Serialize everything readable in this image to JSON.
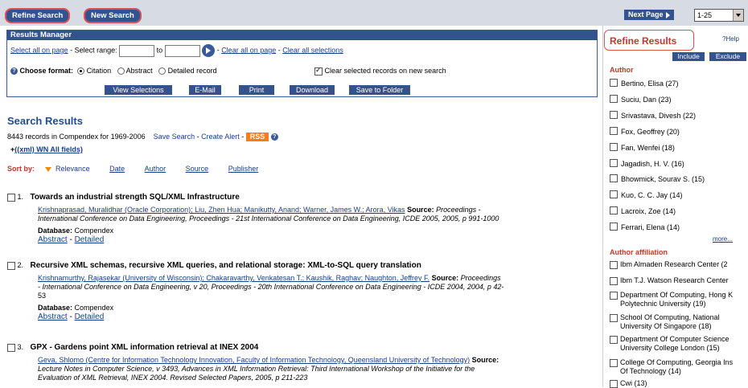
{
  "toolbar": {
    "refine_search": "Refine Search",
    "new_search": "New Search",
    "next_page": "Next Page",
    "page_range": "1-25"
  },
  "results_manager": {
    "title": "Results Manager",
    "select_all_on_page": "Select all on page",
    "select_range": "- Select range:",
    "to": "to",
    "clear_all_on_page": "Clear all on page",
    "clear_all_selections": "Clear all selections",
    "choose_format": "Choose format:",
    "formats": [
      "Citation",
      "Abstract",
      "Detailed record"
    ],
    "selected_format": "Citation",
    "clear_selected": "Clear selected records on new search",
    "buttons": [
      "View Selections",
      "E-Mail",
      "Print",
      "Download",
      "Save to Folder"
    ]
  },
  "results": {
    "title": "Search Results",
    "summary": "8443 records in Compendex for 1969-2006",
    "save_search": "Save Search",
    "create_alert": "Create Alert",
    "rss": "RSS",
    "query": "((xml) WN All fields)",
    "sort_by": "Sort by:",
    "sort_options": [
      "Relevance",
      "Date",
      "Author",
      "Source",
      "Publisher"
    ],
    "items": [
      {
        "num": "1.",
        "title": "Towards an industrial strength SQL/XML Infrastructure",
        "authors_line": "Krishnaprasad, Muralidhar (Oracle Corporation); Liu, Zhen Hua; Manikutty, Anand; Warner, James W.; Arora, Vikas",
        "source_label": "Source:",
        "source_1": "Proceedings -",
        "source_2": "International Conference on Data Engineering, Proceedings - 21st International Conference on Data Engineering, ICDE 2005, 2005, p 991-1000",
        "source_3": "",
        "db_label": "Database:",
        "db": "Compendex",
        "abstract": "Abstract",
        "detailed": "Detailed"
      },
      {
        "num": "2.",
        "title": "Recursive XML schemas, recursive XML queries, and relational storage: XML-to-SQL query translation",
        "authors_line": "Krishnamurthy, Rajasekar (University of Wisconsin); Chakaravarthy, Venkatesan T.; Kaushik, Raghav; Naughton, Jeffrey F.",
        "source_label": "Source:",
        "source_1": "Proceedings",
        "source_2": "- International Conference on Data Engineering, v 20, Proceedings - 20th International Conference on Data Engineering - ICDE 2004, 2004, p 42-",
        "source_3": "53",
        "db_label": "Database:",
        "db": "Compendex",
        "abstract": "Abstract",
        "detailed": "Detailed"
      },
      {
        "num": "3.",
        "title": "GPX - Gardens point XML information retrieval at INEX 2004",
        "authors_line": "Geva, Shlomo (Centre for Information Technology Innovation, Faculty of Information Technology, Queensland University of Technology)",
        "source_label": "Source:",
        "source_1": "",
        "source_2": "Lecture Notes in Computer Science, v 3493, Advances in XML Information Retrieval: Third International Workshop of the Initiative for the",
        "source_3": "Evaluation of XML Retrieval, INEX 2004. Revised Selected Papers, 2005, p 211-223"
      }
    ]
  },
  "refine": {
    "title": "Refine Results",
    "help": "Help",
    "include": "Include",
    "exclude": "Exclude",
    "author_label": "Author",
    "authors": [
      "Bertino, Elisa (27)",
      "Suciu, Dan (23)",
      "Srivastava, Divesh (22)",
      "Fox, Geoffrey (20)",
      "Fan, Wenfei (18)",
      "Jagadish, H. V. (16)",
      "Bhowmick, Sourav S. (15)",
      "Kuo, C. C. Jay (14)",
      "Lacroix, Zoe (14)",
      "Ferrari, Elena (14)"
    ],
    "more": "more...",
    "affiliation_label": "Author affiliation",
    "affiliations": [
      [
        "Ibm Almaden Research Center (2"
      ],
      [
        "Ibm T.J. Watson Research Center"
      ],
      [
        "Department Of Computing, Hong K",
        "Polytechnic University (19)"
      ],
      [
        "School Of Computing, National",
        "University Of Singapore (18)"
      ],
      [
        "Department Of Computer Science",
        "University College London (15)"
      ],
      [
        "College Of Computing, Georgia Ins",
        "Of Technology (14)"
      ],
      [
        "Cwi (13)"
      ]
    ]
  }
}
